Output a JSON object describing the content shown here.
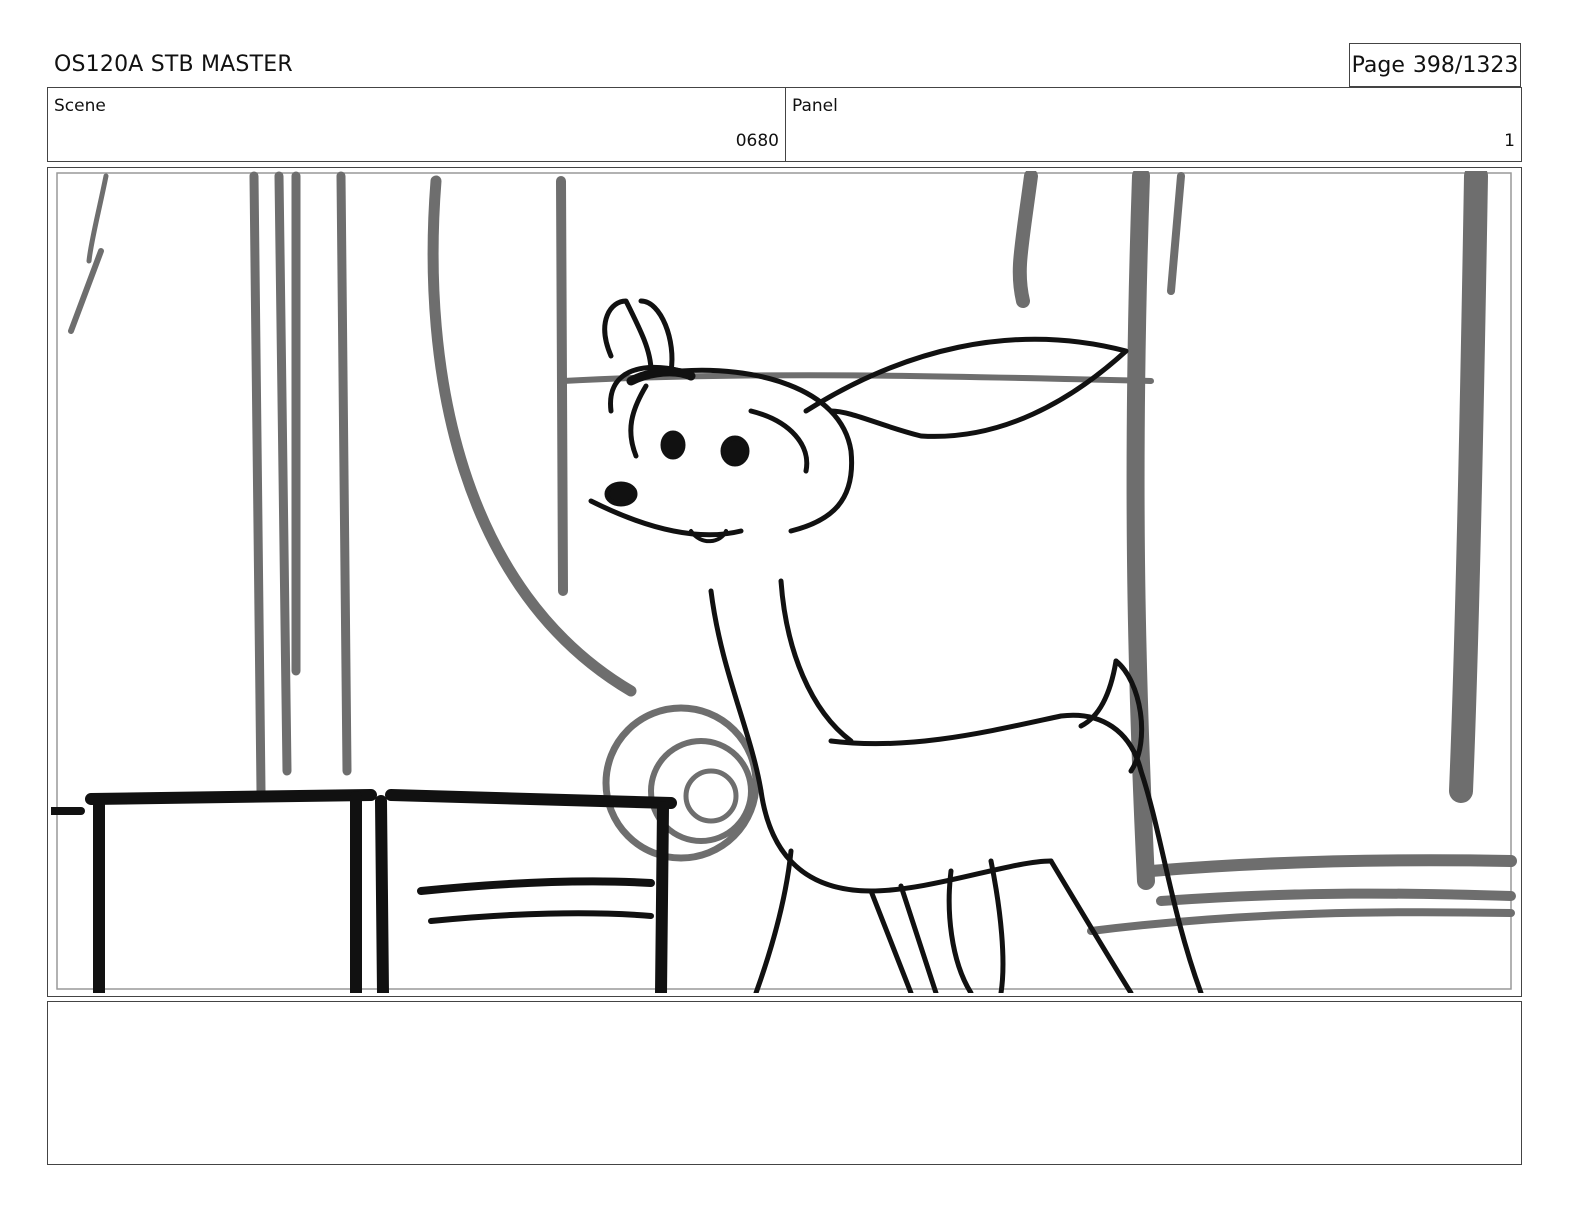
{
  "header": {
    "title": "OS120A STB MASTER",
    "page_label": "Page",
    "page_value": "398/1323"
  },
  "info": {
    "scene_label": "Scene",
    "scene_value": "0680",
    "panel_label": "Panel",
    "panel_value": "1"
  },
  "notes": {
    "text": ""
  },
  "sketch": {
    "line_color": "#111111",
    "background_line_color": "#6e6e6e"
  }
}
